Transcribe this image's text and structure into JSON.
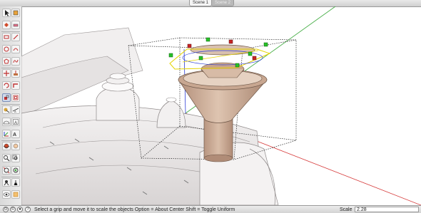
{
  "scene_tabs": [
    {
      "label": "Scene 1",
      "active": true
    },
    {
      "label": "Scene 2",
      "active": false
    }
  ],
  "toolbar": {
    "tools": [
      {
        "icon": "select-arrow-icon"
      },
      {
        "icon": "make-component-icon"
      },
      {
        "icon": "paint-bucket-icon"
      },
      {
        "icon": "eraser-icon"
      },
      {
        "icon": "rectangle-icon"
      },
      {
        "icon": "line-pencil-icon"
      },
      {
        "icon": "circle-icon"
      },
      {
        "icon": "arc-icon"
      },
      {
        "icon": "polygon-icon"
      },
      {
        "icon": "freehand-icon"
      },
      {
        "icon": "move-icon"
      },
      {
        "icon": "push-pull-icon"
      },
      {
        "icon": "rotate-icon"
      },
      {
        "icon": "follow-me-icon"
      },
      {
        "icon": "scale-icon"
      },
      {
        "icon": "offset-icon"
      },
      {
        "icon": "tape-measure-icon"
      },
      {
        "icon": "dimension-icon"
      },
      {
        "icon": "protractor-icon"
      },
      {
        "icon": "text-icon"
      },
      {
        "icon": "axes-icon"
      },
      {
        "icon": "3d-text-icon"
      },
      {
        "icon": "orbit-icon"
      },
      {
        "icon": "pan-icon"
      },
      {
        "icon": "zoom-icon"
      },
      {
        "icon": "zoom-window-icon"
      },
      {
        "icon": "zoom-extents-icon"
      },
      {
        "icon": "previous-view-icon"
      },
      {
        "icon": "position-camera-icon"
      },
      {
        "icon": "walk-icon"
      },
      {
        "icon": "look-around-icon"
      },
      {
        "icon": "section-plane-icon"
      }
    ],
    "selected": "scale-icon"
  },
  "status": {
    "hint": "Select a grip and move it to scale the objects  Option = About Center  Shift = Toggle Uniform",
    "measure_label": "Scale",
    "measure_value": "2.28"
  },
  "colors": {
    "axis_red": "#d63a3a",
    "axis_green": "#3aa83a",
    "axis_blue": "#2f3fd6",
    "grip_green": "#27c127",
    "grip_red": "#c62424",
    "selection_yellow": "#e6d400",
    "stack_brown": "#c9a58c"
  }
}
